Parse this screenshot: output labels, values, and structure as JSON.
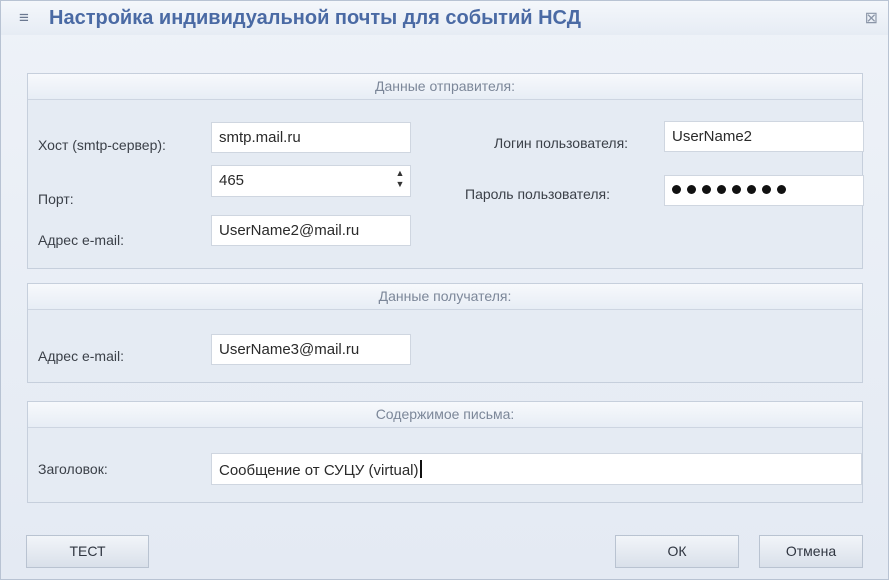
{
  "window": {
    "title": "Настройка индивидуальной почты для событий НСД",
    "title_icon": "≡",
    "close_icon": "⊠"
  },
  "sender": {
    "header": "Данные отправителя:",
    "host_label": "Хост (smtp-сервер):",
    "host_value": "smtp.mail.ru",
    "port_label": "Порт:",
    "port_value": "465",
    "email_label": "Адрес e-mail:",
    "email_value": "UserName2@mail.ru",
    "login_label": "Логин пользователя:",
    "login_value": "UserName2",
    "password_label": "Пароль пользователя:",
    "password_length": 8
  },
  "recipient": {
    "header": "Данные получателя:",
    "email_label": "Адрес e-mail:",
    "email_value": "UserName3@mail.ru"
  },
  "content": {
    "header": "Содержимое письма:",
    "subject_label": "Заголовок:",
    "subject_value": "Сообщение от СУЦУ (virtual)"
  },
  "buttons": {
    "test": "ТЕСТ",
    "ok": "ОК",
    "cancel": "Отмена"
  }
}
